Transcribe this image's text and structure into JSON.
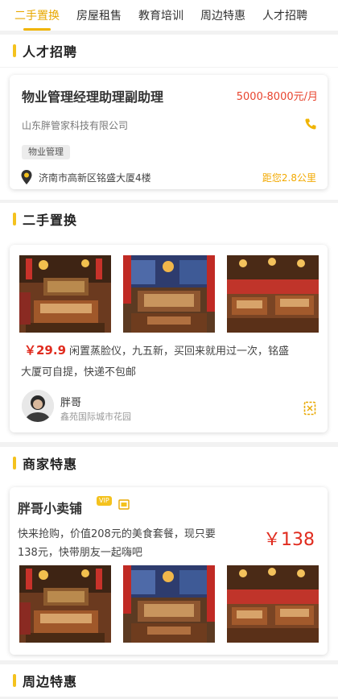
{
  "tabs": [
    {
      "label": "二手置换",
      "active": true
    },
    {
      "label": "房屋租售",
      "active": false
    },
    {
      "label": "教育培训",
      "active": false
    },
    {
      "label": "周边特惠",
      "active": false
    },
    {
      "label": "人才招聘",
      "active": false
    }
  ],
  "jobs": {
    "section_title": "人才招聘",
    "card": {
      "title": "物业管理经理助理副助理",
      "salary": "5000-8000元/月",
      "company": "山东胖管家科技有限公司",
      "tag": "物业管理",
      "address": "济南市高新区铭盛大厦4楼",
      "distance": "距您2.8公里",
      "icons": {
        "phone": "phone-icon",
        "location": "location-pin-icon"
      }
    }
  },
  "secondhand": {
    "section_title": "二手置换",
    "card": {
      "price": "￥29.9",
      "description_line1": "闲置蒸脸仪，九五新，买回来就用过一次，铭盛",
      "description_line2": "大厦可自提，快递不包邮",
      "seller_name": "胖哥",
      "seller_location": "鑫苑国际城市花园",
      "icons": {
        "chat": "chat-icon"
      }
    }
  },
  "merchant": {
    "section_title": "商家特惠",
    "card": {
      "shop_name": "胖哥小卖铺",
      "badge_text": "VIP",
      "description_line1": "快来抢购，价值208元的美食套餐，现只要",
      "description_line2": "138元，快带朋友一起嗨吧",
      "price": "￥138",
      "icons": {
        "badge": "vip-badge-icon",
        "shop": "shop-icon"
      }
    }
  },
  "nearby": {
    "section_title": "周边特惠"
  },
  "colors": {
    "accent": "#f0b400",
    "price_red": "#e02c1f",
    "salary_red": "#e8442e",
    "distance_yellow": "#f2a900",
    "tag_bg": "#ececec"
  }
}
